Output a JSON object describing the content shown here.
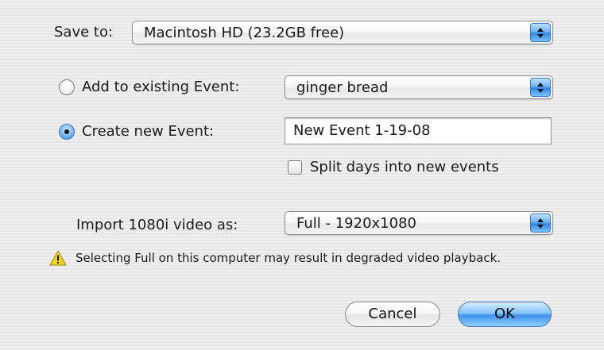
{
  "save_to": {
    "label": "Save to:",
    "selected": "Macintosh HD (23.2GB free)"
  },
  "existing_event": {
    "label": "Add to existing Event:",
    "selected": "ginger bread",
    "checked": false
  },
  "new_event": {
    "label": "Create new Event:",
    "value": "New Event 1-19-08",
    "checked": true
  },
  "split_days": {
    "label": "Split days into new events",
    "checked": false
  },
  "import_video": {
    "label": "Import 1080i video as:",
    "selected": "Full - 1920x1080"
  },
  "warning": {
    "icon": "warning-icon",
    "text": "Selecting Full on this computer may result in degraded video playback."
  },
  "buttons": {
    "cancel": "Cancel",
    "ok": "OK"
  },
  "colors": {
    "accent": "#3f92ea",
    "background": "#ececec",
    "warning": "#f5d21c"
  }
}
